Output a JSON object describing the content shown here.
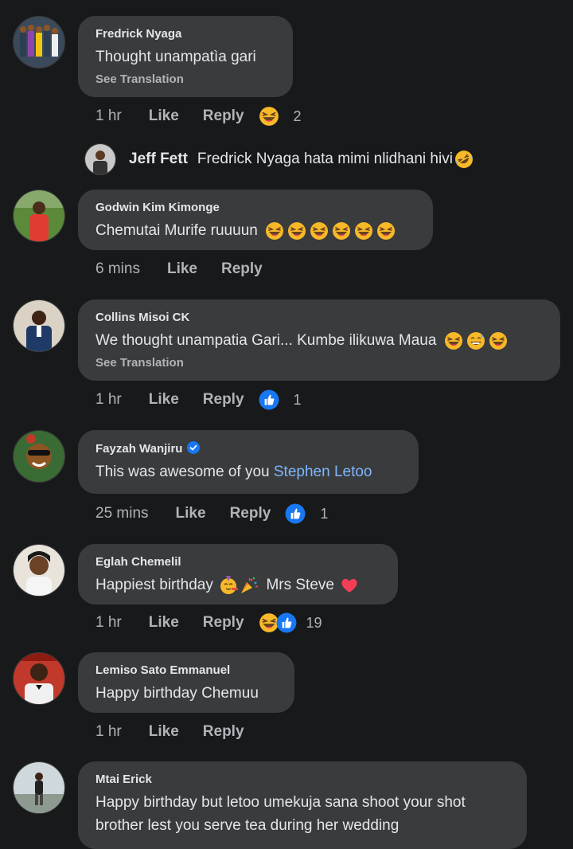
{
  "comments": [
    {
      "name": "Fredrick Nyaga",
      "text": "Thought unampatìa gari",
      "translation": "See Translation",
      "time": "1 hr",
      "like": "Like",
      "reply": "Reply",
      "reaction_count": "2",
      "reactions": [
        "laughing-emoji"
      ]
    },
    {
      "name": "Godwin Kim Kimonge",
      "text": "Chemutai Murife ruuuun",
      "time": "6 mins",
      "like": "Like",
      "reply": "Reply"
    },
    {
      "name": "Collins Misoi CK",
      "text": "We thought unampatia Gari... Kumbe ilikuwa Maua",
      "translation": "See Translation",
      "time": "1 hr",
      "like": "Like",
      "reply": "Reply",
      "reaction_count": "1",
      "reactions": [
        "like-icon"
      ]
    },
    {
      "name": "Fayzah Wanjiru",
      "text": "This was awesome of you",
      "mention": "Stephen Letoo",
      "time": "25 mins",
      "like": "Like",
      "reply": "Reply",
      "reaction_count": "1",
      "reactions": [
        "like-icon"
      ]
    },
    {
      "name": "Eglah Chemelil",
      "text_a": "Happiest birthday",
      "text_b": "Mrs Steve",
      "time": "1 hr",
      "like": "Like",
      "reply": "Reply",
      "reaction_count": "19",
      "reactions": [
        "laughing-emoji",
        "like-icon"
      ]
    },
    {
      "name": "Lemiso Sato Emmanuel",
      "text": "Happy birthday Chemuu",
      "time": "1 hr",
      "like": "Like",
      "reply": "Reply"
    },
    {
      "name": "Mtai Erick",
      "text_line1": "Happy birthday but letoo umekuja sana shoot your shot",
      "text_line2": "brother lest you serve tea during her wedding"
    }
  ],
  "nested_reply": {
    "name": "Jeff Fett",
    "text": "Fredrick Nyaga hata mimi nlidhani hivi"
  },
  "colors": {
    "background": "#18191a",
    "bubble": "#3a3b3c",
    "link": "#7eb6ff",
    "like_blue": "#1877f2",
    "heart": "#f33e58"
  }
}
